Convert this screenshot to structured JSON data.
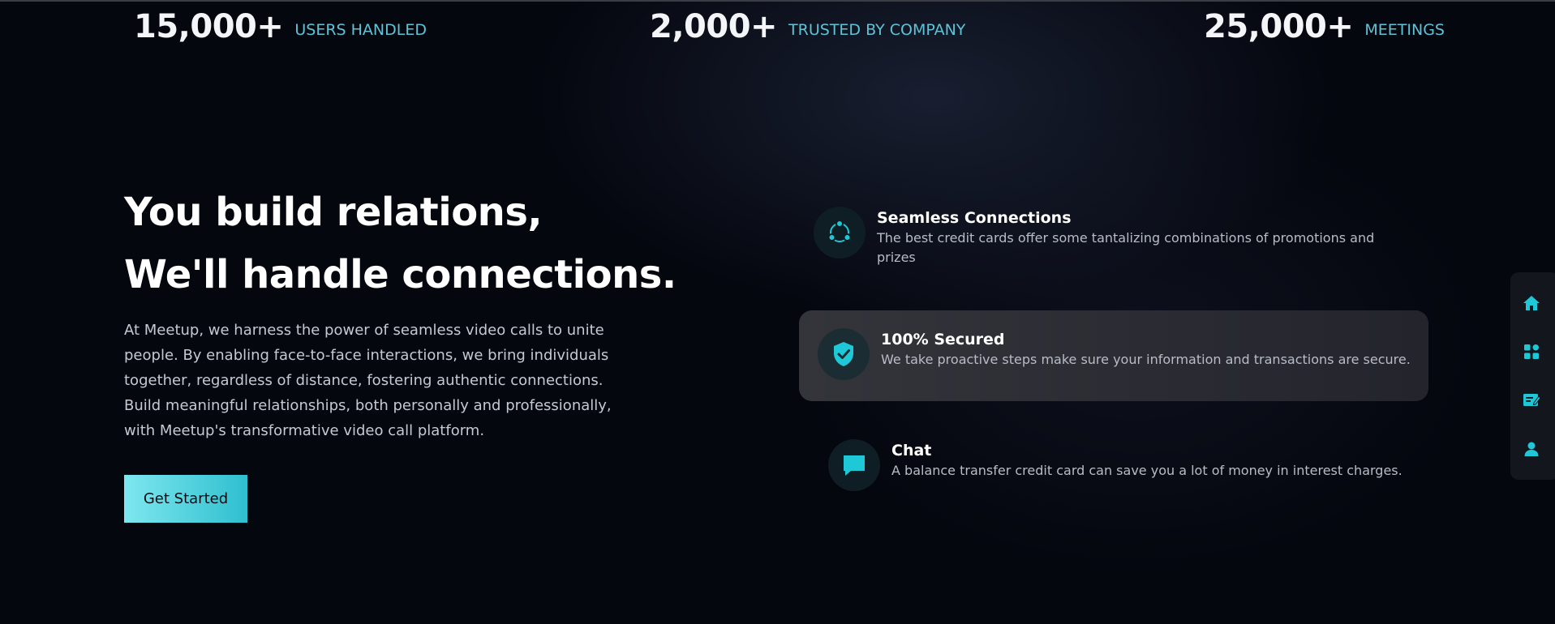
{
  "stats": [
    {
      "number": "15,000+",
      "label": "USERS HANDLED"
    },
    {
      "number": "2,000+",
      "label": "TRUSTED BY COMPANY"
    },
    {
      "number": "25,000+",
      "label": "MEETINGS"
    }
  ],
  "hero": {
    "title_line1": "You build relations,",
    "title_line2": "We'll handle connections.",
    "description": "At Meetup, we harness the power of seamless video calls to unite people. By enabling face-to-face interactions, we bring individuals together, regardless of distance, fostering authentic connections. Build meaningful relationships, both personally and professionally, with Meetup's transformative video call platform.",
    "cta_label": "Get Started"
  },
  "features": [
    {
      "title": "Seamless Connections",
      "description": "The best credit cards offer some tantalizing combinations of promotions and prizes",
      "icon": "share-icon"
    },
    {
      "title": "100% Secured",
      "description": "We take proactive steps make sure your information and transactions are secure.",
      "icon": "shield-check-icon"
    },
    {
      "title": "Chat",
      "description": "A balance transfer credit card can save you a lot of money in interest charges.",
      "icon": "chat-bubble-icon"
    }
  ],
  "dock": [
    "home-icon",
    "dashboard-icon",
    "notes-icon",
    "profile-icon"
  ],
  "colors": {
    "accent": "#1ec8d6",
    "background": "#05070f",
    "stat_label": "#5ec3d6"
  }
}
